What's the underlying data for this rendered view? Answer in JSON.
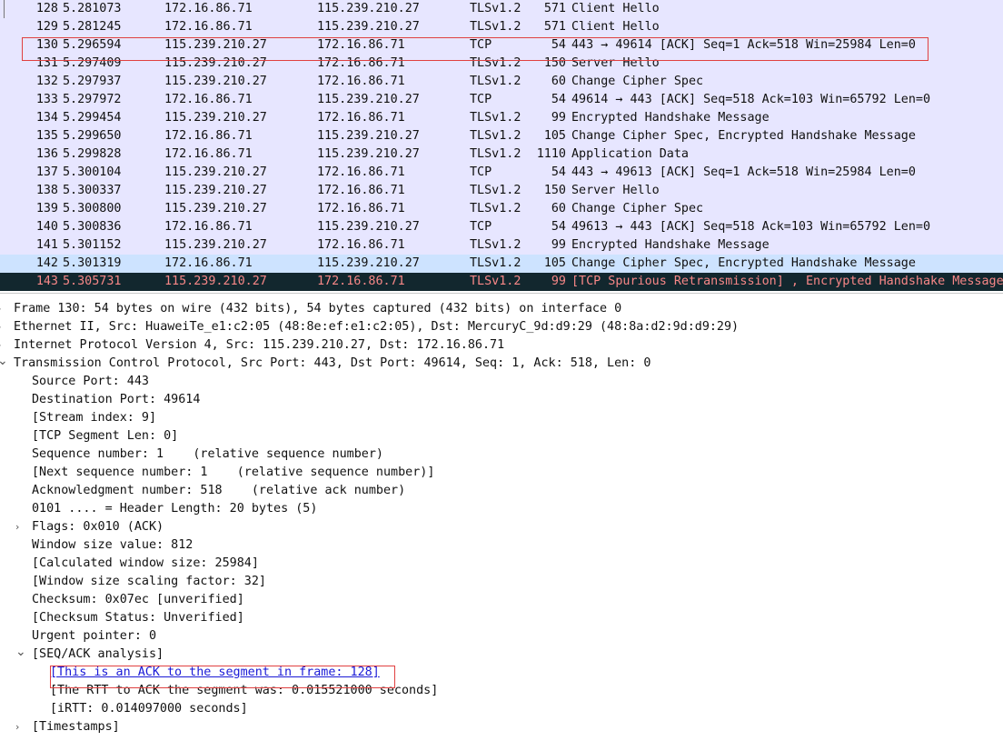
{
  "packets": [
    {
      "no": "128",
      "time": "5.281073",
      "src": "172.16.86.71",
      "dst": "115.239.210.27",
      "proto": "TLSv1.2",
      "len": "571",
      "info": "Client Hello",
      "style": "normal"
    },
    {
      "no": "129",
      "time": "5.281245",
      "src": "172.16.86.71",
      "dst": "115.239.210.27",
      "proto": "TLSv1.2",
      "len": "571",
      "info": "Client Hello",
      "style": "normal"
    },
    {
      "no": "130",
      "time": "5.296594",
      "src": "115.239.210.27",
      "dst": "172.16.86.71",
      "proto": "TCP",
      "len": "54",
      "info": "443 → 49614 [ACK] Seq=1 Ack=518 Win=25984 Len=0",
      "style": "normal"
    },
    {
      "no": "131",
      "time": "5.297409",
      "src": "115.239.210.27",
      "dst": "172.16.86.71",
      "proto": "TLSv1.2",
      "len": "150",
      "info": "Server Hello",
      "style": "normal"
    },
    {
      "no": "132",
      "time": "5.297937",
      "src": "115.239.210.27",
      "dst": "172.16.86.71",
      "proto": "TLSv1.2",
      "len": "60",
      "info": "Change Cipher Spec",
      "style": "normal"
    },
    {
      "no": "133",
      "time": "5.297972",
      "src": "172.16.86.71",
      "dst": "115.239.210.27",
      "proto": "TCP",
      "len": "54",
      "info": "49614 → 443 [ACK] Seq=518 Ack=103 Win=65792 Len=0",
      "style": "normal"
    },
    {
      "no": "134",
      "time": "5.299454",
      "src": "115.239.210.27",
      "dst": "172.16.86.71",
      "proto": "TLSv1.2",
      "len": "99",
      "info": "Encrypted Handshake Message",
      "style": "normal"
    },
    {
      "no": "135",
      "time": "5.299650",
      "src": "172.16.86.71",
      "dst": "115.239.210.27",
      "proto": "TLSv1.2",
      "len": "105",
      "info": "Change Cipher Spec, Encrypted Handshake Message",
      "style": "normal"
    },
    {
      "no": "136",
      "time": "5.299828",
      "src": "172.16.86.71",
      "dst": "115.239.210.27",
      "proto": "TLSv1.2",
      "len": "1110",
      "info": "Application Data",
      "style": "normal"
    },
    {
      "no": "137",
      "time": "5.300104",
      "src": "115.239.210.27",
      "dst": "172.16.86.71",
      "proto": "TCP",
      "len": "54",
      "info": "443 → 49613 [ACK] Seq=1 Ack=518 Win=25984 Len=0",
      "style": "normal"
    },
    {
      "no": "138",
      "time": "5.300337",
      "src": "115.239.210.27",
      "dst": "172.16.86.71",
      "proto": "TLSv1.2",
      "len": "150",
      "info": "Server Hello",
      "style": "normal"
    },
    {
      "no": "139",
      "time": "5.300800",
      "src": "115.239.210.27",
      "dst": "172.16.86.71",
      "proto": "TLSv1.2",
      "len": "60",
      "info": "Change Cipher Spec",
      "style": "normal"
    },
    {
      "no": "140",
      "time": "5.300836",
      "src": "172.16.86.71",
      "dst": "115.239.210.27",
      "proto": "TCP",
      "len": "54",
      "info": "49613 → 443 [ACK] Seq=518 Ack=103 Win=65792 Len=0",
      "style": "normal"
    },
    {
      "no": "141",
      "time": "5.301152",
      "src": "115.239.210.27",
      "dst": "172.16.86.71",
      "proto": "TLSv1.2",
      "len": "99",
      "info": "Encrypted Handshake Message",
      "style": "normal"
    },
    {
      "no": "142",
      "time": "5.301319",
      "src": "172.16.86.71",
      "dst": "115.239.210.27",
      "proto": "TLSv1.2",
      "len": "105",
      "info": "Change Cipher Spec, Encrypted Handshake Message",
      "style": "selected"
    },
    {
      "no": "143",
      "time": "5.305731",
      "src": "115.239.210.27",
      "dst": "172.16.86.71",
      "proto": "TLSv1.2",
      "len": "99",
      "info": "[TCP Spurious Retransmission] , Encrypted Handshake Message",
      "style": "warning"
    }
  ],
  "details": [
    {
      "text": "Frame 130: 54 bytes on wire (432 bits), 54 bytes captured (432 bits) on interface 0",
      "depth": 0,
      "expander": "collapsed"
    },
    {
      "text": "Ethernet II, Src: HuaweiTe_e1:c2:05 (48:8e:ef:e1:c2:05), Dst: MercuryC_9d:d9:29 (48:8a:d2:9d:d9:29)",
      "depth": 0,
      "expander": "collapsed"
    },
    {
      "text": "Internet Protocol Version 4, Src: 115.239.210.27, Dst: 172.16.86.71",
      "depth": 0,
      "expander": "collapsed"
    },
    {
      "text": "Transmission Control Protocol, Src Port: 443, Dst Port: 49614, Seq: 1, Ack: 518, Len: 0",
      "depth": 0,
      "expander": "expanded"
    },
    {
      "text": "Source Port: 443",
      "depth": 1,
      "expander": "none"
    },
    {
      "text": "Destination Port: 49614",
      "depth": 1,
      "expander": "none"
    },
    {
      "text": "[Stream index: 9]",
      "depth": 1,
      "expander": "none"
    },
    {
      "text": "[TCP Segment Len: 0]",
      "depth": 1,
      "expander": "none"
    },
    {
      "text": "Sequence number: 1    (relative sequence number)",
      "depth": 1,
      "expander": "none"
    },
    {
      "text": "[Next sequence number: 1    (relative sequence number)]",
      "depth": 1,
      "expander": "none"
    },
    {
      "text": "Acknowledgment number: 518    (relative ack number)",
      "depth": 1,
      "expander": "none"
    },
    {
      "text": "0101 .... = Header Length: 20 bytes (5)",
      "depth": 1,
      "expander": "none"
    },
    {
      "text": "Flags: 0x010 (ACK)",
      "depth": 1,
      "expander": "collapsed"
    },
    {
      "text": "Window size value: 812",
      "depth": 1,
      "expander": "none"
    },
    {
      "text": "[Calculated window size: 25984]",
      "depth": 1,
      "expander": "none"
    },
    {
      "text": "[Window size scaling factor: 32]",
      "depth": 1,
      "expander": "none"
    },
    {
      "text": "Checksum: 0x07ec [unverified]",
      "depth": 1,
      "expander": "none"
    },
    {
      "text": "[Checksum Status: Unverified]",
      "depth": 1,
      "expander": "none"
    },
    {
      "text": "Urgent pointer: 0",
      "depth": 1,
      "expander": "none"
    },
    {
      "text": "[SEQ/ACK analysis]",
      "depth": 1,
      "expander": "expanded"
    },
    {
      "text": "[This is an ACK to the segment in frame: 128]",
      "depth": 2,
      "expander": "none",
      "link": true
    },
    {
      "text": "[The RTT to ACK the segment was: 0.015521000 seconds]",
      "depth": 2,
      "expander": "none"
    },
    {
      "text": "[iRTT: 0.014097000 seconds]",
      "depth": 2,
      "expander": "none"
    },
    {
      "text": "[Timestamps]",
      "depth": 1,
      "expander": "collapsed"
    }
  ],
  "icons": {
    "collapsed": "chevron-right-icon",
    "expanded": "chevron-down-icon"
  },
  "colors": {
    "row_bg": "#e7e6ff",
    "selected_bg": "#cde3ff",
    "warning_bg": "#12272e",
    "warning_fg": "#f78787",
    "annotation_box": "#e04040",
    "link": "#1a1ad6"
  }
}
